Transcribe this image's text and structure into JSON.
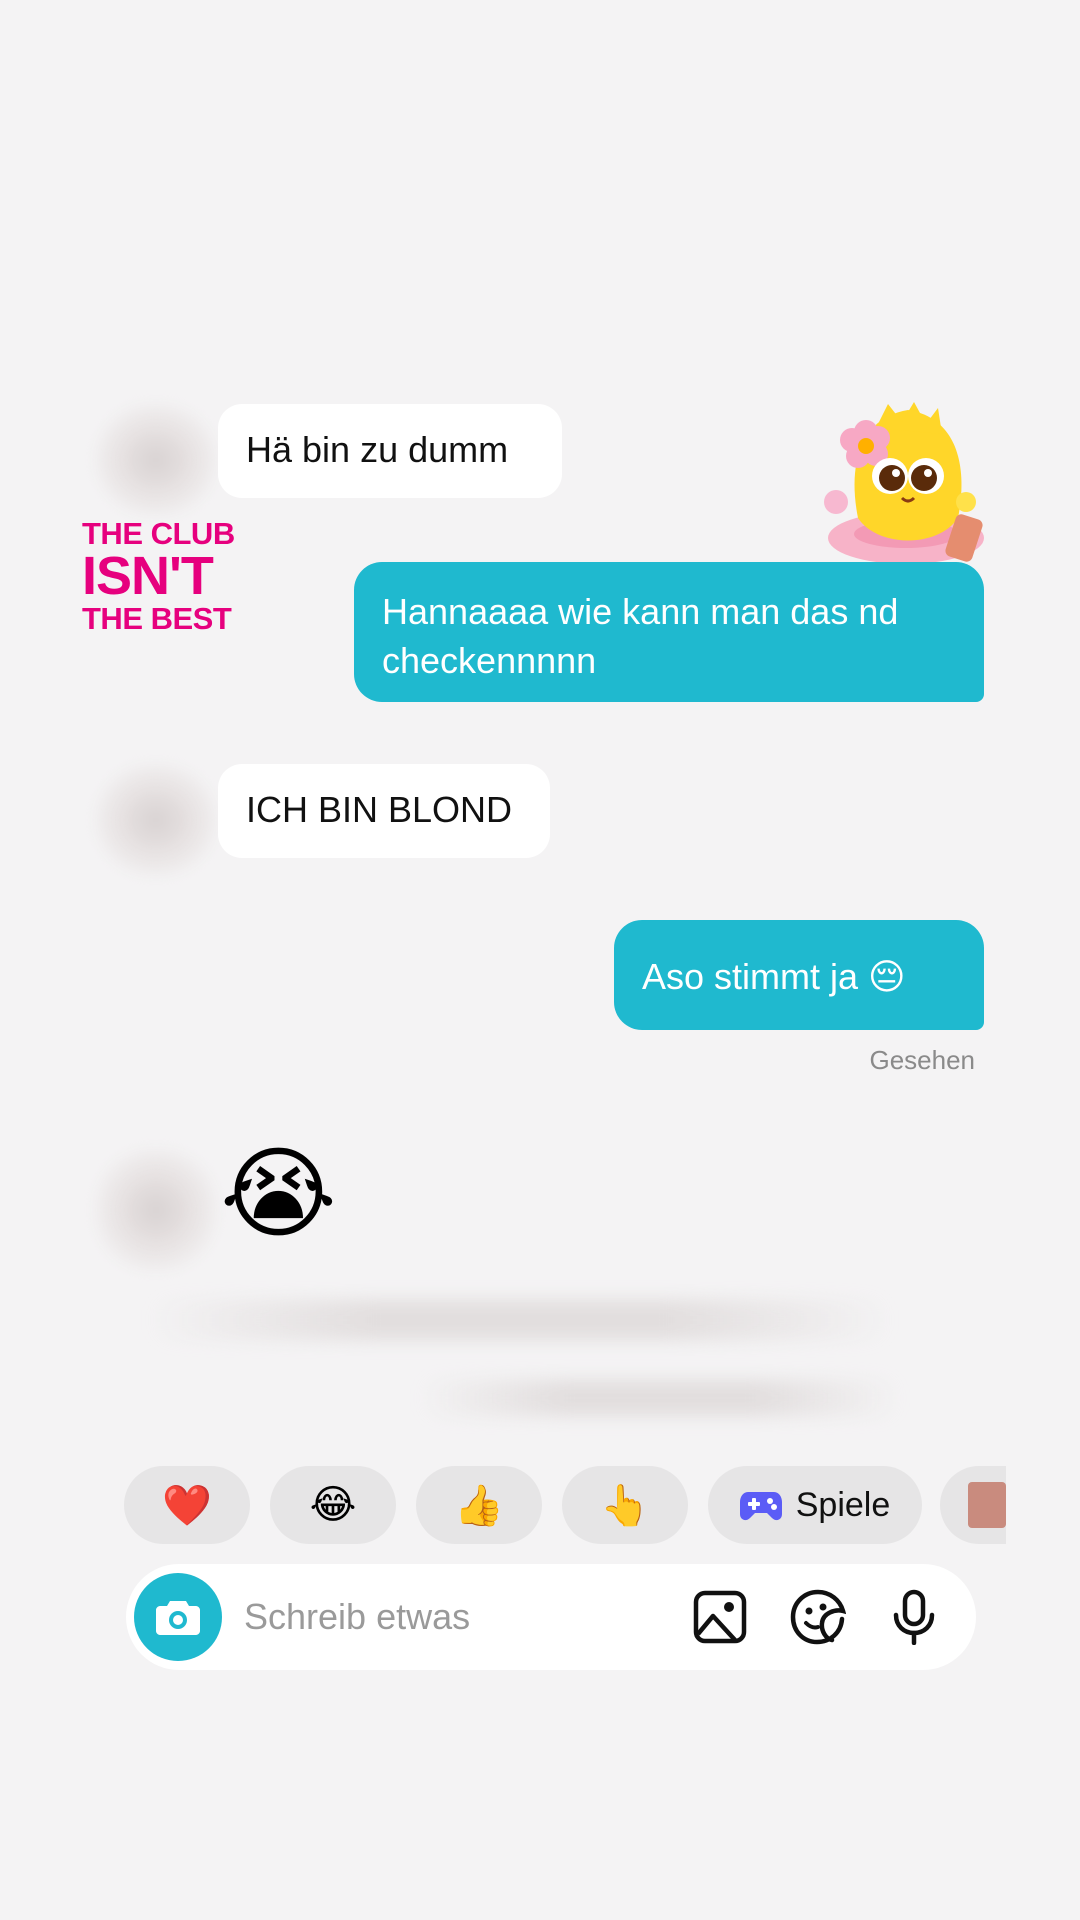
{
  "messages": [
    {
      "direction": "incoming",
      "text": "Hä bin zu dumm"
    },
    {
      "direction": "outgoing",
      "text": "Hannaaaa wie kann man das nd checkennnnn"
    },
    {
      "direction": "incoming",
      "text": "ICH BIN BLOND"
    },
    {
      "direction": "outgoing",
      "text": "Aso stimmt ja 😔"
    },
    {
      "direction": "incoming",
      "text": "😭"
    }
  ],
  "status": {
    "seen_label": "Gesehen"
  },
  "watermark": {
    "line1": "THE CLUB",
    "line2": "ISN'T",
    "line3": "THE BEST"
  },
  "quick_reactions": [
    {
      "emoji": "❤️"
    },
    {
      "emoji": "😂"
    },
    {
      "emoji": "👍"
    },
    {
      "emoji": "👆"
    },
    {
      "icon": "gamepad-icon",
      "label": "Spiele"
    }
  ],
  "composer": {
    "placeholder": "Schreib etwas"
  },
  "colors": {
    "accent": "#1fb9cf",
    "background": "#f4f3f4",
    "watermark": "#e6007e"
  }
}
